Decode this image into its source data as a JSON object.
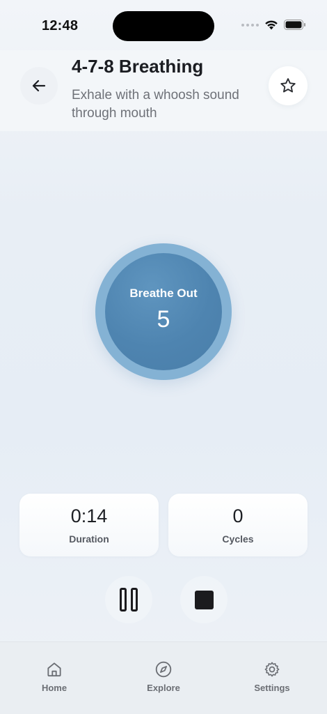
{
  "status_bar": {
    "time": "12:48"
  },
  "header": {
    "title": "4-7-8 Breathing",
    "subtitle": "Exhale with a whoosh sound through mouth"
  },
  "breathing": {
    "phase": "Breathe Out",
    "count": "5"
  },
  "stats": [
    {
      "value": "0:14",
      "label": "Duration"
    },
    {
      "value": "0",
      "label": "Cycles"
    }
  ],
  "tabs": [
    {
      "label": "Home",
      "icon": "home-icon"
    },
    {
      "label": "Explore",
      "icon": "compass-icon"
    },
    {
      "label": "Settings",
      "icon": "gear-icon"
    }
  ],
  "colors": {
    "circle_outer": "#84b2d4",
    "circle_inner": "#4e84b0",
    "background": "#e8eef5"
  }
}
